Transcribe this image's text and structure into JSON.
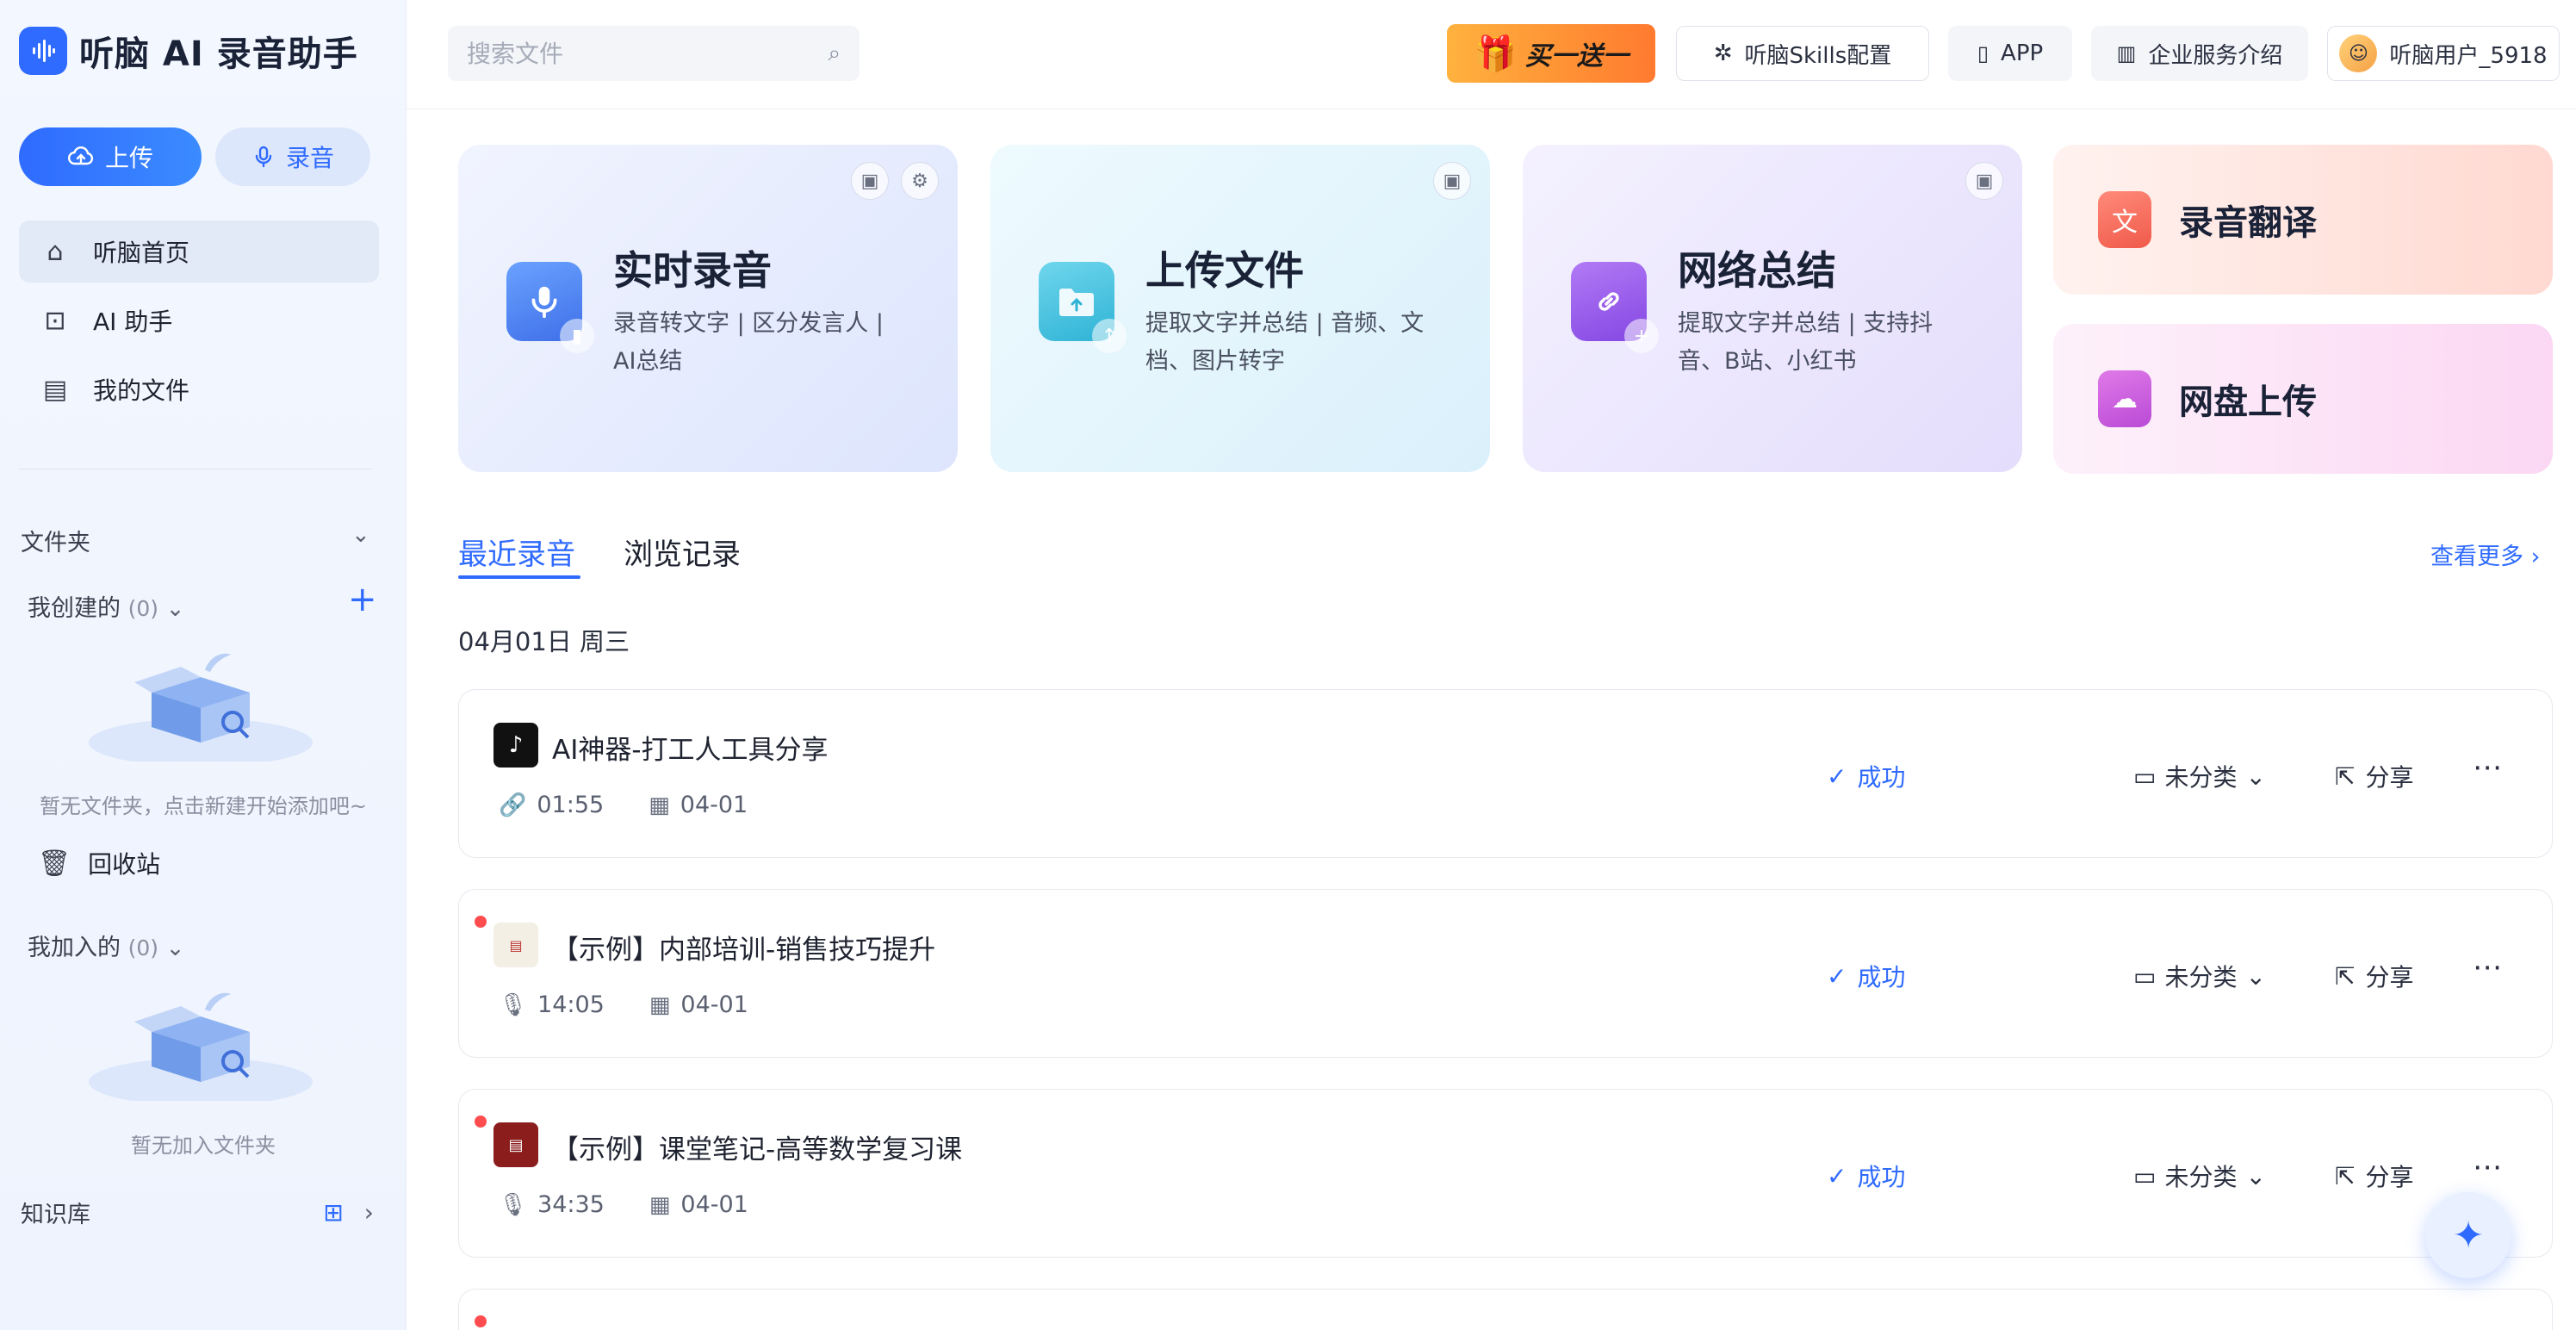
{
  "app": {
    "title": "听脑 AI 录音助手"
  },
  "sidebar": {
    "upload_label": "上传",
    "record_label": "录音",
    "nav": [
      {
        "label": "听脑首页"
      },
      {
        "label": "AI 助手"
      },
      {
        "label": "我的文件"
      }
    ],
    "folders_title": "文件夹",
    "created": {
      "label": "我创建的",
      "count": "(0)",
      "empty": "暂无文件夹，点击新建开始添加吧~"
    },
    "trash_label": "回收站",
    "joined": {
      "label": "我加入的",
      "count": "(0)",
      "empty": "暂无加入文件夹"
    },
    "kb_label": "知识库"
  },
  "header": {
    "search_placeholder": "搜索文件",
    "promo_label": "买一送一",
    "skills_label": "听脑Skills配置",
    "app_label": "APP",
    "enterprise_label": "企业服务介绍",
    "user_name": "听脑用户_5918"
  },
  "cards": [
    {
      "title": "实时录音",
      "desc": "录音转文字 | 区分发言人 | AI总结"
    },
    {
      "title": "上传文件",
      "desc": "提取文字并总结 | 音频、文档、图片转字"
    },
    {
      "title": "网络总结",
      "desc": "提取文字并总结 | 支持抖音、B站、小红书"
    }
  ],
  "side_cards": [
    {
      "title": "录音翻译"
    },
    {
      "title": "网盘上传"
    }
  ],
  "tabs": [
    {
      "label": "最近录音"
    },
    {
      "label": "浏览记录"
    }
  ],
  "more_label": "查看更多",
  "date_label": "04月01日 周三",
  "rows": [
    {
      "title": "AI神器-打工人工具分享",
      "duration": "01:55",
      "date": "04-01",
      "status": "成功",
      "category": "未分类",
      "share": "分享"
    },
    {
      "title": "【示例】内部培训-销售技巧提升",
      "duration": "14:05",
      "date": "04-01",
      "status": "成功",
      "category": "未分类",
      "share": "分享"
    },
    {
      "title": "【示例】课堂笔记-高等数学复习课",
      "duration": "34:35",
      "date": "04-01",
      "status": "成功",
      "category": "未分类",
      "share": "分享"
    }
  ],
  "icons": {
    "upload": "cloud-upload-icon",
    "record": "mic-icon",
    "home": "home-icon",
    "ai": "robot-icon",
    "files": "document-icon",
    "search": "search-icon",
    "gift": "gift-icon",
    "skills": "skills-icon",
    "phone": "phone-icon",
    "building": "building-icon",
    "trash": "trash-icon",
    "folder_add": "folder-add-icon",
    "link": "link-icon",
    "calendar": "calendar-icon",
    "check": "check-circle-icon",
    "share": "share-icon",
    "more": "more-icon",
    "assistant": "assistant-bot-icon"
  },
  "colors": {
    "accent": "#2f6bff",
    "promo_start": "#ffb23e",
    "promo_end": "#ff7a2f",
    "danger": "#ff4d4f"
  }
}
